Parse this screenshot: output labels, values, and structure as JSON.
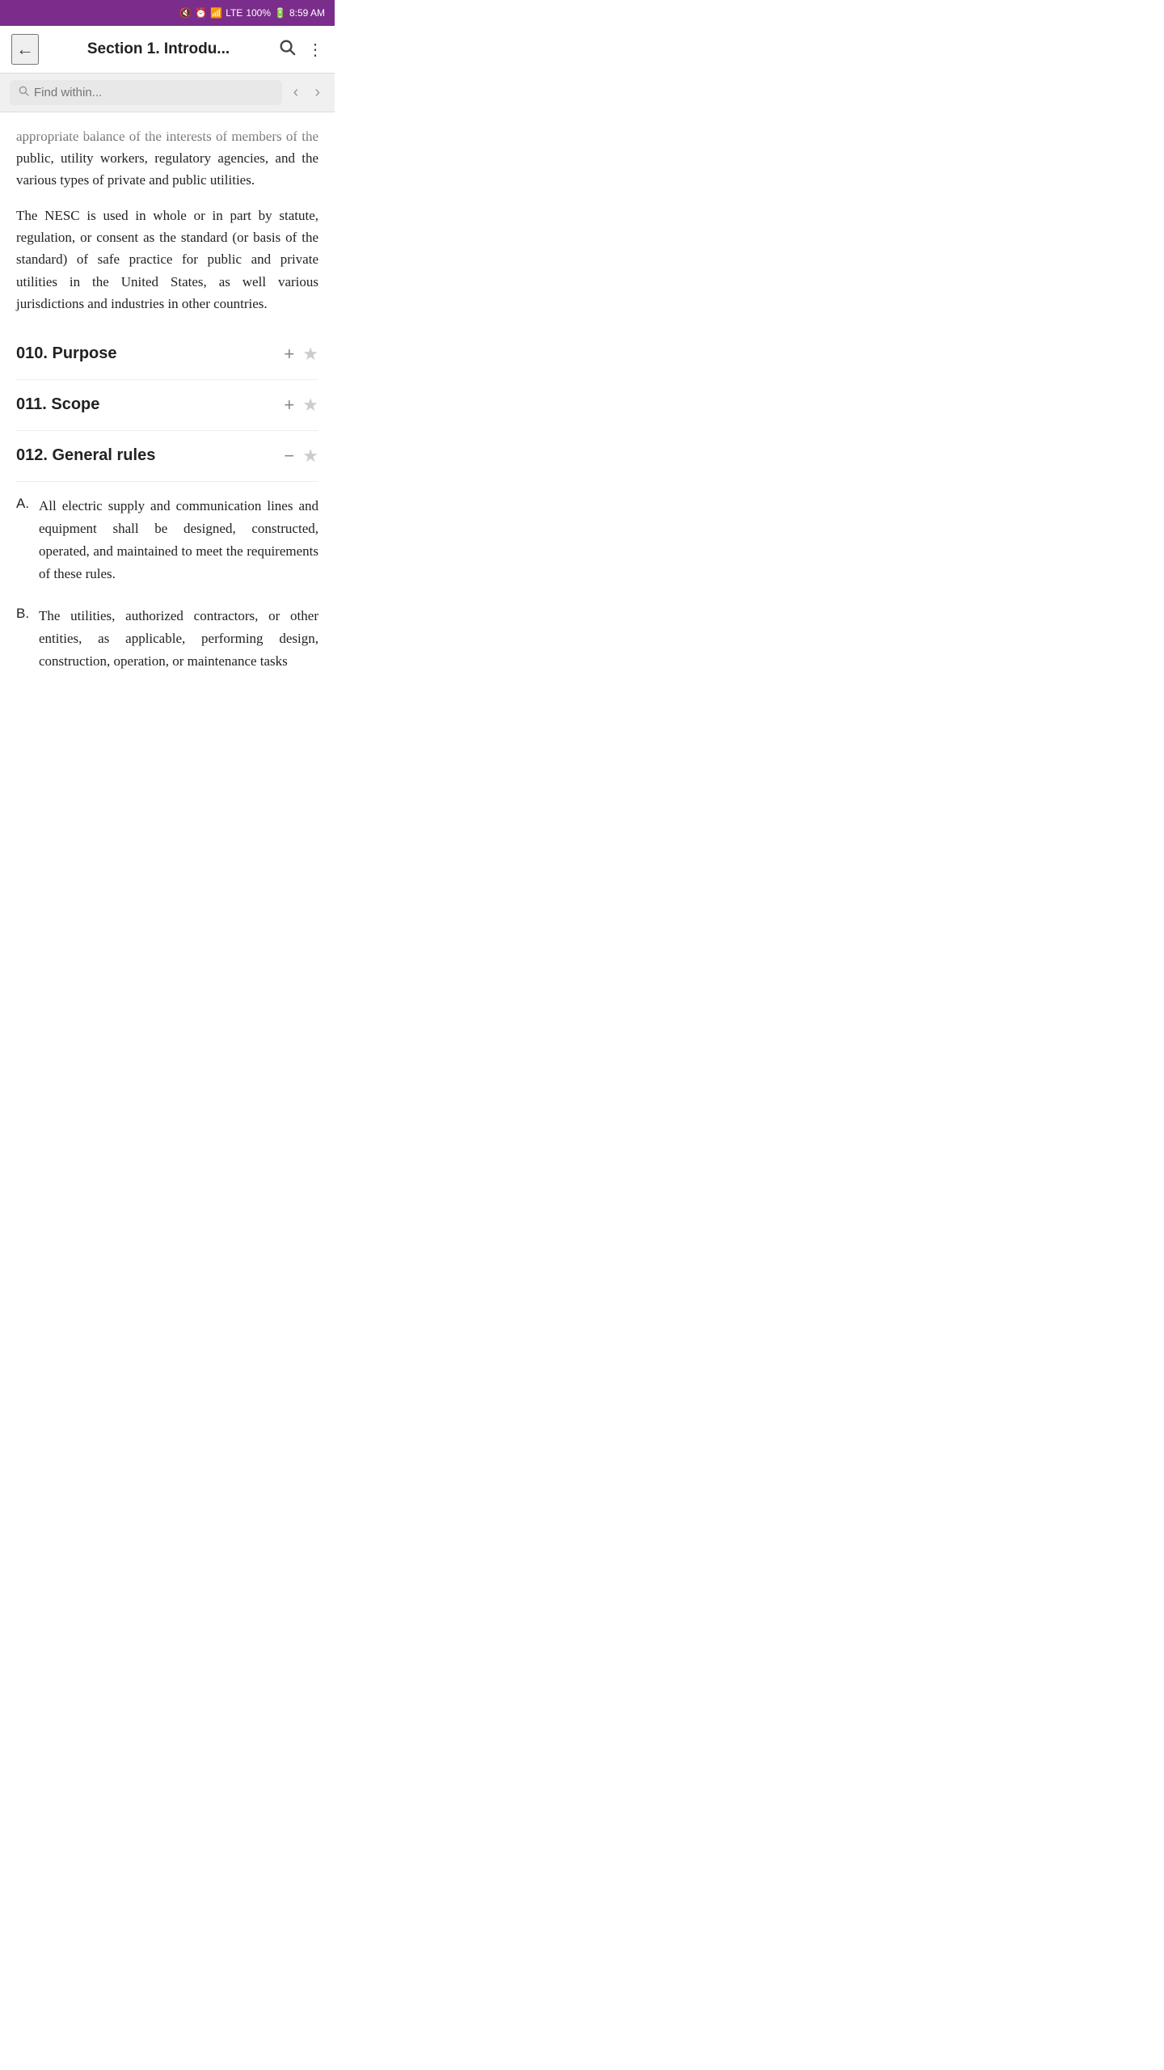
{
  "statusBar": {
    "time": "8:59 AM",
    "battery": "100%",
    "signal": "LTE"
  },
  "appBar": {
    "title": "Section 1. Introdu...",
    "backLabel": "←",
    "searchLabel": "⌕",
    "moreLabel": "⋮"
  },
  "searchBar": {
    "placeholder": "Find within...",
    "prevLabel": "‹",
    "nextLabel": "›"
  },
  "content": {
    "topParagraph": "appropriate balance of the interests of members of the public, utility workers, regulatory agencies, and the various types of private and public utilities.",
    "secondParagraph": "The NESC is used in whole or in part by statute, regulation, or consent as the standard (or basis of the standard) of safe practice for public and private utilities in the United States, as well various jurisdictions and industries in other countries.",
    "sections": [
      {
        "id": "010",
        "title": "010. Purpose",
        "expandIcon": "+",
        "starIcon": "★",
        "expanded": false
      },
      {
        "id": "011",
        "title": "011. Scope",
        "expandIcon": "+",
        "starIcon": "★",
        "expanded": false
      },
      {
        "id": "012",
        "title": "012. General rules",
        "expandIcon": "−",
        "starIcon": "★",
        "expanded": true,
        "subItems": [
          {
            "letter": "A.",
            "text": "All electric supply and communication lines and equipment shall be designed, constructed, operated, and maintained to meet the requirements of these rules."
          },
          {
            "letter": "B.",
            "text": "The utilities, authorized contractors, or other entities, as applicable, performing design, construction, operation, or maintenance tasks"
          }
        ]
      }
    ]
  }
}
